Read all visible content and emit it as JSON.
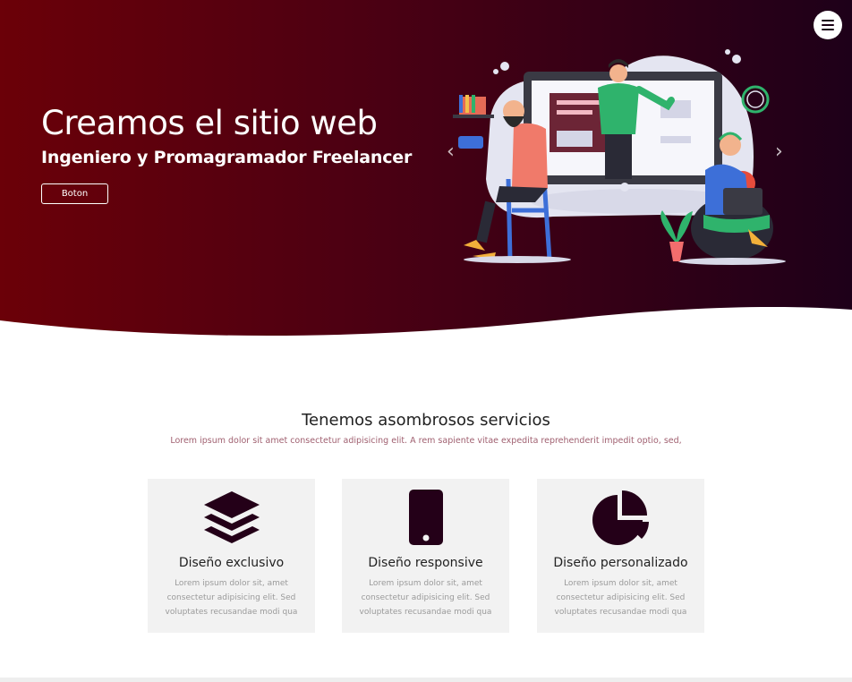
{
  "hero": {
    "title": "Creamos el sitio web",
    "subtitle": "Ingeniero y Promagramador Freelancer",
    "button_label": "Boton",
    "prev_glyph": "‹",
    "next_glyph": "›"
  },
  "nav": {
    "menu_icon": "hamburger-menu-icon"
  },
  "services": {
    "title": "Tenemos asombrosos servicios",
    "subtitle": "Lorem ipsum dolor sit amet consectetur adipisicing elit. A rem sapiente vitae expedita reprehenderit impedit optio, sed,",
    "cards": [
      {
        "icon": "layers-icon",
        "title": "Diseño exclusivo",
        "text": "Lorem ipsum dolor sit, amet consectetur adipisicing elit. Sed voluptates recusandae modi qua"
      },
      {
        "icon": "mobile-phone-icon",
        "title": "Diseño responsive",
        "text": "Lorem ipsum dolor sit, amet consectetur adipisicing elit. Sed voluptates recusandae modi qua"
      },
      {
        "icon": "pie-chart-icon",
        "title": "Diseño personalizado",
        "text": "Lorem ipsum dolor sit, amet consectetur adipisicing elit. Sed voluptates recusandae modi qua"
      }
    ]
  },
  "colors": {
    "hero_gradient_start": "#6b0008",
    "hero_gradient_end": "#1e0019",
    "icon_color": "#240018",
    "card_background": "#f2f2f2"
  }
}
